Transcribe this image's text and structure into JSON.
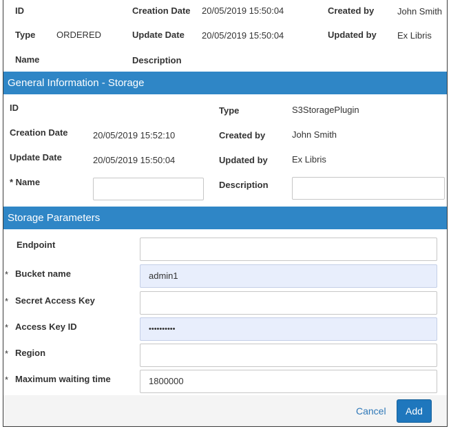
{
  "top_info": {
    "id_label": "ID",
    "creation_date_label": "Creation Date",
    "creation_date_value": "20/05/2019 15:50:04",
    "created_by_label": "Created by",
    "created_by_value": "John Smith",
    "type_label": "Type",
    "type_value": "ORDERED",
    "update_date_label": "Update Date",
    "update_date_value": "20/05/2019 15:50:04",
    "updated_by_label": "Updated by",
    "updated_by_value": "Ex Libris",
    "name_label": "Name",
    "description_label": "Description"
  },
  "general": {
    "header": "General Information - Storage",
    "id_label": "ID",
    "type_label": "Type",
    "type_value": "S3StoragePlugin",
    "creation_date_label": "Creation Date",
    "creation_date_value": "20/05/2019 15:52:10",
    "created_by_label": "Created by",
    "created_by_value": "John Smith",
    "update_date_label": "Update Date",
    "update_date_value": "20/05/2019 15:50:04",
    "updated_by_label": "Updated by",
    "updated_by_value": "Ex Libris",
    "name_label": "* Name",
    "name_value": "",
    "description_label": "Description",
    "description_value": ""
  },
  "storage": {
    "header": "Storage Parameters",
    "required_marker": "*",
    "endpoint_label": "Endpoint",
    "endpoint_value": "",
    "bucket_label": "Bucket name",
    "bucket_value": "admin1",
    "secret_label": "Secret Access Key",
    "secret_value": "",
    "access_key_label": "Access Key ID",
    "access_key_value": "••••••••••",
    "region_label": "Region",
    "region_value": "",
    "max_wait_label": "Maximum waiting time",
    "max_wait_value": "1800000"
  },
  "actions": {
    "cancel_label": "Cancel",
    "add_label": "Add"
  },
  "colors": {
    "section_header_bg": "#2f86c6",
    "primary_button": "#1f77bd",
    "link": "#2f78b8",
    "autofill_bg": "#e8eefc"
  }
}
